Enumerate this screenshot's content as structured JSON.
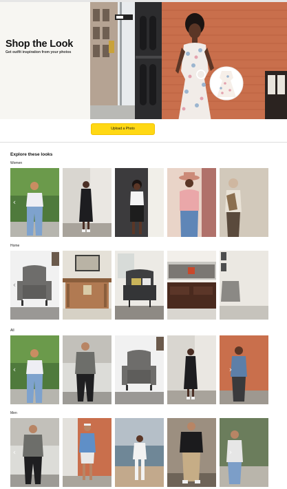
{
  "hero": {
    "title": "Shop the Look",
    "subtitle": "Get outfit inspiration from your photos"
  },
  "upload": {
    "label": "Upload a Photo"
  },
  "explore": {
    "title": "Explore these looks"
  },
  "sections": [
    {
      "label": "Women"
    },
    {
      "label": "Home"
    },
    {
      "label": "All"
    },
    {
      "label": "Men"
    }
  ],
  "icons": {
    "prev": "chevron-left-icon",
    "next": "chevron-right-icon"
  },
  "colors": {
    "cta": "#ffd814",
    "hero_bg": "#f7f6f2",
    "brick": "#c96f4c"
  }
}
